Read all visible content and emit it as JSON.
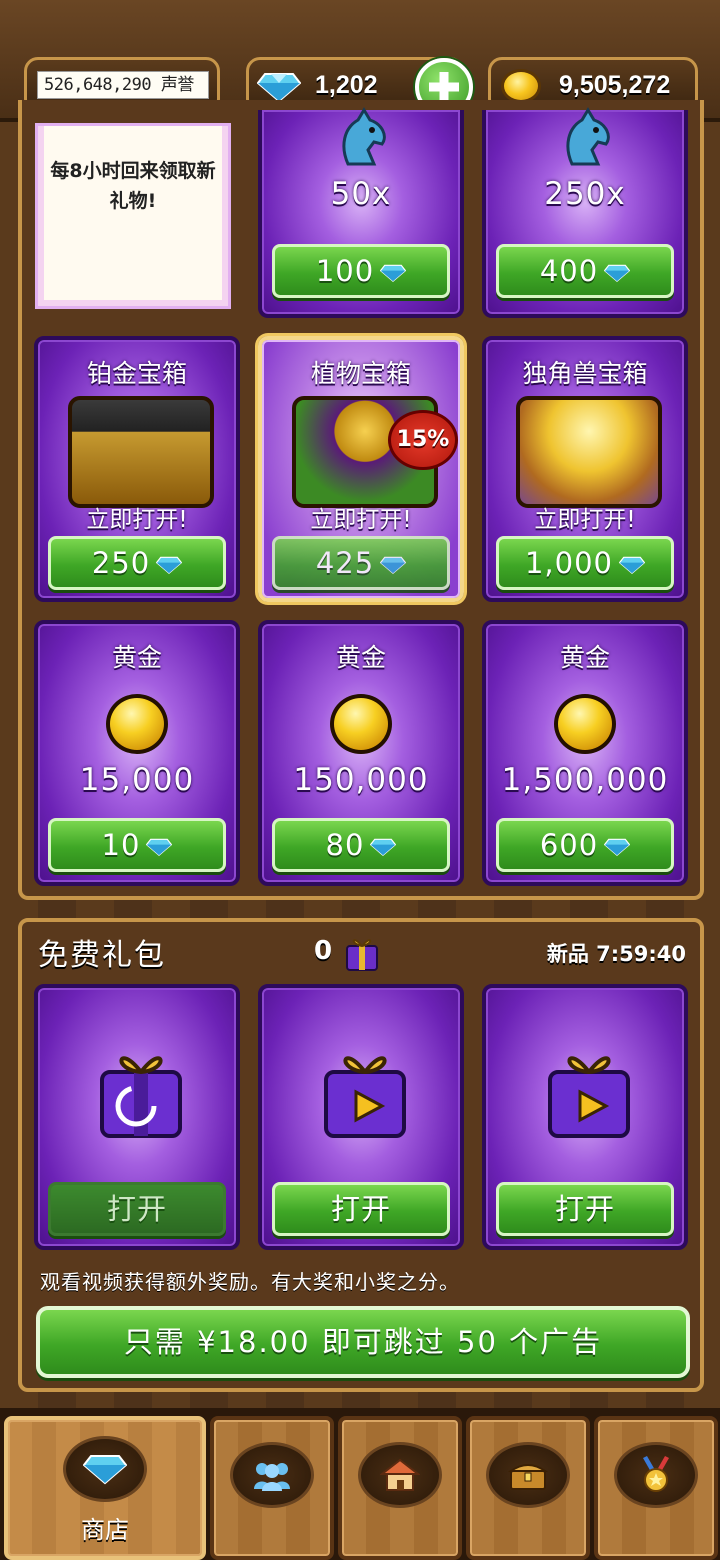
{
  "topbar": {
    "reputation": "526,648,290 声誉",
    "gems": "1,202",
    "gold": "9,505,272"
  },
  "shop": {
    "free_note": "每8小时回来领取新礼物!",
    "horses": [
      {
        "amount": "50x",
        "price": "100"
      },
      {
        "amount": "250x",
        "price": "400"
      }
    ],
    "chests": [
      {
        "title": "铂金宝箱",
        "open": "立即打开!",
        "price": "250"
      },
      {
        "title": "植物宝箱",
        "open": "立即打开!",
        "price": "425",
        "badge": "15%"
      },
      {
        "title": "独角兽宝箱",
        "open": "立即打开!",
        "price": "1,000"
      }
    ],
    "gold_packs": [
      {
        "title": "黄金",
        "amount": "15,000",
        "price": "10"
      },
      {
        "title": "黄金",
        "amount": "150,000",
        "price": "80"
      },
      {
        "title": "黄金",
        "amount": "1,500,000",
        "price": "600"
      }
    ]
  },
  "free_gifts": {
    "title": "免费礼包",
    "count": "0",
    "timer": "新品 7:59:40",
    "open_label": "打开",
    "hint": "观看视频获得额外奖励。有大奖和小奖之分。",
    "skip_ads": "只需 ¥18.00 即可跳过 50 个广告"
  },
  "nav": {
    "shop_label": "商店"
  },
  "colors": {
    "accent_green": "#3fa726",
    "card_purple": "#6c22b6",
    "wood": "#b07a3c"
  },
  "icons": [
    "diamond-icon",
    "plus-icon",
    "gold-coin-icon",
    "horse-icon",
    "gift-box-icon",
    "people-icon",
    "house-icon",
    "treasure-chest-icon",
    "medal-icon"
  ]
}
